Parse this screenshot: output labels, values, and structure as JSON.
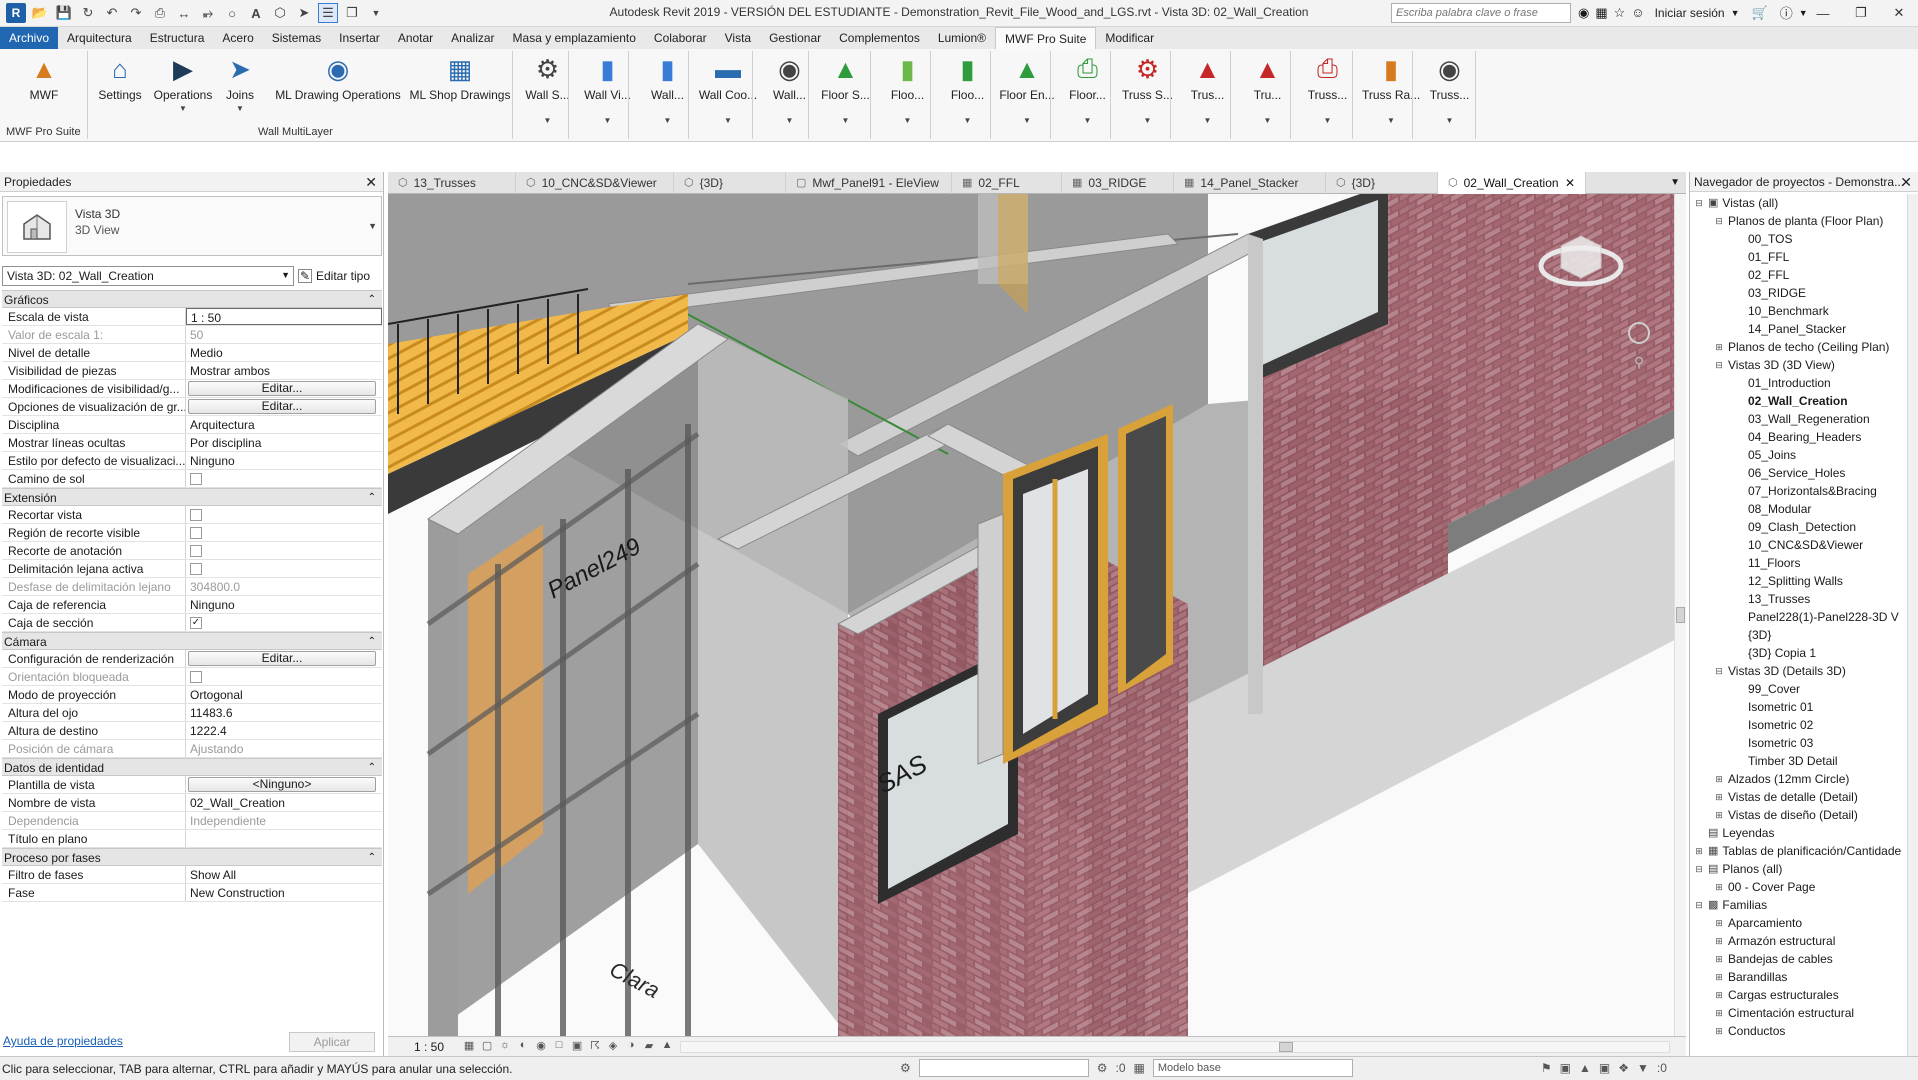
{
  "titlebar": {
    "title": "Autodesk Revit 2019 - VERSIÓN DEL ESTUDIANTE - Demonstration_Revit_File_Wood_and_LGS.rvt - Vista 3D: 02_Wall_Creation",
    "search_placeholder": "Escriba palabra clave o frase",
    "signin": "Iniciar sesión"
  },
  "menu": [
    "Archivo",
    "Arquitectura",
    "Estructura",
    "Acero",
    "Sistemas",
    "Insertar",
    "Anotar",
    "Analizar",
    "Masa y emplazamiento",
    "Colaborar",
    "Vista",
    "Gestionar",
    "Complementos",
    "Lumion®",
    "MWF Pro Suite",
    "Modificar"
  ],
  "ribbon": {
    "buttons": [
      {
        "label": "MWF",
        "icon": "mwf-logo-icon",
        "color": "#d67c1e"
      },
      {
        "label": "Settings",
        "icon": "settings-house-icon",
        "color": "#2b6cb0"
      },
      {
        "label": "Operations",
        "icon": "play-circle-icon",
        "color": "#1f3b5a"
      },
      {
        "label": "Joins",
        "icon": "joins-icon",
        "color": "#2b6cb0"
      },
      {
        "label": "ML Drawing Operations",
        "icon": "ml-drawing-icon",
        "color": "#2b6cb0"
      },
      {
        "label": "ML Shop Drawings",
        "icon": "ml-shop-icon",
        "color": "#2b6cb0"
      },
      {
        "label": "Wall S...",
        "icon": "wall-settings-icon",
        "color": "#444444"
      },
      {
        "label": "Wall Vi...",
        "icon": "wall-view-icon",
        "color": "#3a7bd5"
      },
      {
        "label": "Wall...",
        "icon": "wall-icon",
        "color": "#3a7bd5"
      },
      {
        "label": "Wall Coo...",
        "icon": "wall-coordinate-icon",
        "color": "#2b6cb0"
      },
      {
        "label": "Wall...",
        "icon": "wall-eye-icon",
        "color": "#444444"
      },
      {
        "label": "Floor S...",
        "icon": "floor-settings-icon",
        "color": "#2e9b3c"
      },
      {
        "label": "Floo...",
        "icon": "floor-icon",
        "color": "#6cb84a"
      },
      {
        "label": "Floo...",
        "icon": "floor-export-icon",
        "color": "#2e9b3c"
      },
      {
        "label": "Floor En...",
        "icon": "floor-engine-icon",
        "color": "#2e9b3c"
      },
      {
        "label": "Floor...",
        "icon": "floor-print-icon",
        "color": "#2e9b3c"
      },
      {
        "label": "Truss S...",
        "icon": "truss-settings-icon",
        "color": "#c62828"
      },
      {
        "label": "Trus...",
        "icon": "truss-warning-icon",
        "color": "#c62828"
      },
      {
        "label": "Tru...",
        "icon": "truss-icon",
        "color": "#c62828"
      },
      {
        "label": "Truss...",
        "icon": "truss-print-icon",
        "color": "#c62828"
      },
      {
        "label": "Truss Ra...",
        "icon": "truss-rafter-icon",
        "color": "#d67c1e"
      },
      {
        "label": "Truss...",
        "icon": "truss-eye-icon",
        "color": "#444444"
      }
    ],
    "panels": [
      "MWF Pro Suite",
      "Wall MultiLayer"
    ]
  },
  "properties": {
    "title": "Propiedades",
    "type_name": "Vista 3D",
    "type_sub": "3D View",
    "view_selector": "Vista 3D: 02_Wall_Creation",
    "edit_type": "Editar tipo",
    "help": "Ayuda de propiedades",
    "apply": "Aplicar",
    "groups": [
      {
        "name": "Gráficos",
        "rows": [
          {
            "label": "Escala de vista",
            "value": "1 : 50",
            "kind": "input"
          },
          {
            "label": "Valor de escala    1:",
            "value": "50",
            "dim": true
          },
          {
            "label": "Nivel de detalle",
            "value": "Medio"
          },
          {
            "label": "Visibilidad de piezas",
            "value": "Mostrar ambos"
          },
          {
            "label": "Modificaciones de visibilidad/g...",
            "value": "Editar...",
            "kind": "button"
          },
          {
            "label": "Opciones de visualización de gr...",
            "value": "Editar...",
            "kind": "button"
          },
          {
            "label": "Disciplina",
            "value": "Arquitectura"
          },
          {
            "label": "Mostrar líneas ocultas",
            "value": "Por disciplina"
          },
          {
            "label": "Estilo por defecto de visualizaci...",
            "value": "Ninguno"
          },
          {
            "label": "Camino de sol",
            "value": "",
            "kind": "checkbox",
            "checked": false
          }
        ]
      },
      {
        "name": "Extensión",
        "rows": [
          {
            "label": "Recortar vista",
            "value": "",
            "kind": "checkbox",
            "checked": false
          },
          {
            "label": "Región de recorte visible",
            "value": "",
            "kind": "checkbox",
            "checked": false
          },
          {
            "label": "Recorte de anotación",
            "value": "",
            "kind": "checkbox",
            "checked": false
          },
          {
            "label": "Delimitación lejana activa",
            "value": "",
            "kind": "checkbox",
            "checked": false
          },
          {
            "label": "Desfase de delimitación lejano",
            "value": "304800.0",
            "dim": true
          },
          {
            "label": "Caja de referencia",
            "value": "Ninguno"
          },
          {
            "label": "Caja de sección",
            "value": "",
            "kind": "checkbox",
            "checked": true
          }
        ]
      },
      {
        "name": "Cámara",
        "rows": [
          {
            "label": "Configuración de renderización",
            "value": "Editar...",
            "kind": "button"
          },
          {
            "label": "Orientación bloqueada",
            "value": "",
            "kind": "checkbox",
            "checked": false,
            "dim": true
          },
          {
            "label": "Modo de proyección",
            "value": "Ortogonal"
          },
          {
            "label": "Altura del ojo",
            "value": "11483.6"
          },
          {
            "label": "Altura de destino",
            "value": "1222.4"
          },
          {
            "label": "Posición de cámara",
            "value": "Ajustando",
            "dim": true
          }
        ]
      },
      {
        "name": "Datos de identidad",
        "rows": [
          {
            "label": "Plantilla de vista",
            "value": "<Ninguno>",
            "kind": "button"
          },
          {
            "label": "Nombre de vista",
            "value": "02_Wall_Creation"
          },
          {
            "label": "Dependencia",
            "value": "Independiente",
            "dim": true
          },
          {
            "label": "Título en plano",
            "value": ""
          }
        ]
      },
      {
        "name": "Proceso por fases",
        "rows": [
          {
            "label": "Filtro de fases",
            "value": "Show All"
          },
          {
            "label": "Fase",
            "value": "New Construction"
          }
        ]
      }
    ]
  },
  "view_tabs": [
    {
      "label": "13_Trusses",
      "active": false
    },
    {
      "label": "10_CNC&SD&Viewer",
      "active": false
    },
    {
      "label": "{3D}",
      "active": false
    },
    {
      "label": "Mwf_Panel91 - EleView",
      "active": false
    },
    {
      "label": "02_FFL",
      "active": false
    },
    {
      "label": "03_RIDGE",
      "active": false
    },
    {
      "label": "14_Panel_Stacker",
      "active": false
    },
    {
      "label": "{3D}",
      "active": false
    },
    {
      "label": "02_Wall_Creation",
      "active": true
    }
  ],
  "canvas": {
    "labels": [
      "Panel249",
      "SAS",
      "Clara"
    ]
  },
  "view_bar": {
    "scale": "1 : 50"
  },
  "browser": {
    "title": "Navegador de proyectos - Demonstra...",
    "nodes": [
      {
        "label": "Vistas (all)",
        "level": 0,
        "toggle": "−",
        "icon": "views-icon"
      },
      {
        "label": "Planos de planta (Floor Plan)",
        "level": 1,
        "toggle": "−"
      },
      {
        "label": "00_TOS",
        "level": 2
      },
      {
        "label": "01_FFL",
        "level": 2
      },
      {
        "label": "02_FFL",
        "level": 2
      },
      {
        "label": "03_RIDGE",
        "level": 2
      },
      {
        "label": "10_Benchmark",
        "level": 2
      },
      {
        "label": "14_Panel_Stacker",
        "level": 2
      },
      {
        "label": "Planos de techo (Ceiling Plan)",
        "level": 1,
        "toggle": "+"
      },
      {
        "label": "Vistas 3D (3D View)",
        "level": 1,
        "toggle": "−"
      },
      {
        "label": "01_Introduction",
        "level": 2
      },
      {
        "label": "02_Wall_Creation",
        "level": 2,
        "selected": true
      },
      {
        "label": "03_Wall_Regeneration",
        "level": 2
      },
      {
        "label": "04_Bearing_Headers",
        "level": 2
      },
      {
        "label": "05_Joins",
        "level": 2
      },
      {
        "label": "06_Service_Holes",
        "level": 2
      },
      {
        "label": "07_Horizontals&Bracing",
        "level": 2
      },
      {
        "label": "08_Modular",
        "level": 2
      },
      {
        "label": "09_Clash_Detection",
        "level": 2
      },
      {
        "label": "10_CNC&SD&Viewer",
        "level": 2
      },
      {
        "label": "11_Floors",
        "level": 2
      },
      {
        "label": "12_Splitting Walls",
        "level": 2
      },
      {
        "label": "13_Trusses",
        "level": 2
      },
      {
        "label": "Panel228(1)-Panel228-3D V",
        "level": 2
      },
      {
        "label": "{3D}",
        "level": 2
      },
      {
        "label": "{3D} Copia 1",
        "level": 2
      },
      {
        "label": "Vistas 3D (Details 3D)",
        "level": 1,
        "toggle": "−"
      },
      {
        "label": "99_Cover",
        "level": 2
      },
      {
        "label": "Isometric 01",
        "level": 2
      },
      {
        "label": "Isometric 02",
        "level": 2
      },
      {
        "label": "Isometric 03",
        "level": 2
      },
      {
        "label": "Timber 3D Detail",
        "level": 2
      },
      {
        "label": "Alzados (12mm Circle)",
        "level": 1,
        "toggle": "+"
      },
      {
        "label": "Vistas de detalle (Detail)",
        "level": 1,
        "toggle": "+"
      },
      {
        "label": "Vistas de diseño (Detail)",
        "level": 1,
        "toggle": "+"
      },
      {
        "label": "Leyendas",
        "level": 0,
        "icon": "legend-icon"
      },
      {
        "label": "Tablas de planificación/Cantidade",
        "level": 0,
        "toggle": "+",
        "icon": "schedule-icon"
      },
      {
        "label": "Planos (all)",
        "level": 0,
        "toggle": "−",
        "icon": "sheets-icon"
      },
      {
        "label": "00 - Cover Page",
        "level": 1,
        "toggle": "+"
      },
      {
        "label": "Familias",
        "level": 0,
        "toggle": "−",
        "icon": "families-icon"
      },
      {
        "label": "Aparcamiento",
        "level": 1,
        "toggle": "+"
      },
      {
        "label": "Armazón estructural",
        "level": 1,
        "toggle": "+"
      },
      {
        "label": "Bandejas de cables",
        "level": 1,
        "toggle": "+"
      },
      {
        "label": "Barandillas",
        "level": 1,
        "toggle": "+"
      },
      {
        "label": "Cargas estructurales",
        "level": 1,
        "toggle": "+"
      },
      {
        "label": "Cimentación estructural",
        "level": 1,
        "toggle": "+"
      },
      {
        "label": "Conductos",
        "level": 1,
        "toggle": "+"
      }
    ]
  },
  "status": {
    "text": "Clic para seleccionar, TAB para alternar, CTRL para añadir y MAYÚS para anular una selección.",
    "model": "Modelo base",
    "count_a": ":0",
    "count_b": ":0"
  }
}
